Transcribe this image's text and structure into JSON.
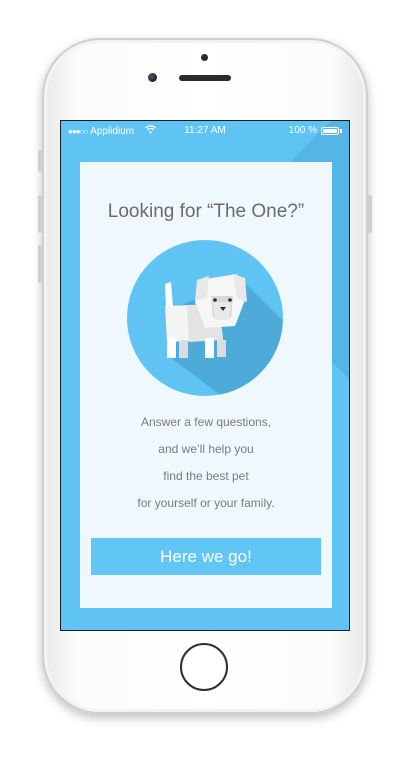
{
  "status_bar": {
    "signal": "●●●○○",
    "carrier": "Applidium",
    "wifi_icon": "wifi-icon",
    "time": "11:27 AM",
    "battery": "100 %"
  },
  "onboarding": {
    "title": "Looking for “The One?”",
    "illustration": "dog-icon",
    "copy_lines": [
      "Answer a few questions,",
      "and we’ll help you",
      "find the best pet",
      "for yourself or your family."
    ],
    "cta_label": "Here we go!"
  },
  "colors": {
    "background_blue": "#5fc4f4",
    "card": "#eff8fd",
    "button": "#62c6f4",
    "text": "#7a7a7a"
  }
}
